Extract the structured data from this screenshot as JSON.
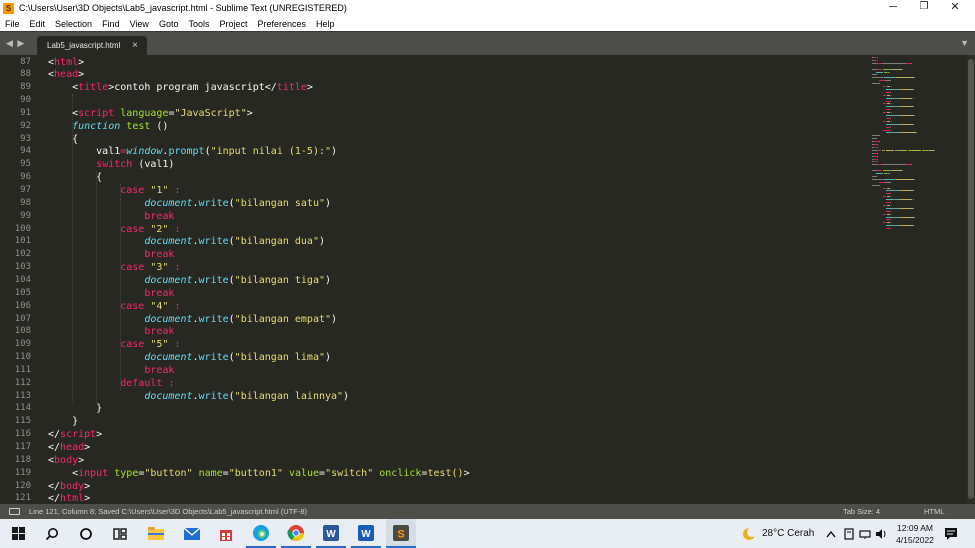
{
  "window": {
    "title": "C:\\Users\\User\\3D Objects\\Lab5_javascript.html - Sublime Text (UNREGISTERED)",
    "minimize": "─",
    "restore": "❐",
    "close": "✕"
  },
  "menu": [
    "File",
    "Edit",
    "Selection",
    "Find",
    "View",
    "Goto",
    "Tools",
    "Project",
    "Preferences",
    "Help"
  ],
  "tabbar": {
    "nav_arrows": "◀ ▶",
    "active_tab": "Lab5_javascript.html",
    "close_glyph": "×",
    "overflow_glyph": "▼"
  },
  "editor": {
    "line_numbers": [
      "87",
      "88",
      "89",
      "90",
      "91",
      "92",
      "93",
      "94",
      "95",
      "96",
      "97",
      "98",
      "99",
      "100",
      "101",
      "102",
      "103",
      "104",
      "105",
      "106",
      "107",
      "108",
      "109",
      "110",
      "111",
      "112",
      "113",
      "114",
      "115",
      "116",
      "117",
      "118",
      "119",
      "120",
      "121"
    ],
    "colors": {
      "background": "#272822",
      "tag": "#f92672",
      "attribute": "#a6e22e",
      "string": "#e6db74",
      "storage": "#66d9ef",
      "text": "#f8f8f2",
      "gutter": "#8f908a"
    },
    "lines": [
      [
        {
          "t": "<",
          "c": "text"
        },
        {
          "t": "html",
          "c": "tag"
        },
        {
          "t": ">",
          "c": "text"
        }
      ],
      [
        {
          "t": "<",
          "c": "text"
        },
        {
          "t": "head",
          "c": "tag"
        },
        {
          "t": ">",
          "c": "text"
        }
      ],
      [
        {
          "t": "    <",
          "c": "text"
        },
        {
          "t": "title",
          "c": "tag"
        },
        {
          "t": ">contoh program javascript</",
          "c": "text"
        },
        {
          "t": "title",
          "c": "tag"
        },
        {
          "t": ">",
          "c": "text"
        }
      ],
      [
        {
          "t": "",
          "c": "text"
        }
      ],
      [
        {
          "t": "    <",
          "c": "text"
        },
        {
          "t": "script",
          "c": "tag"
        },
        {
          "t": " ",
          "c": "text"
        },
        {
          "t": "language",
          "c": "attr"
        },
        {
          "t": "=",
          "c": "text"
        },
        {
          "t": "\"JavaScript\"",
          "c": "str"
        },
        {
          "t": ">",
          "c": "text"
        }
      ],
      [
        {
          "t": "    ",
          "c": "text"
        },
        {
          "t": "function",
          "c": "stor"
        },
        {
          "t": " ",
          "c": "text"
        },
        {
          "t": "test",
          "c": "fn"
        },
        {
          "t": " ()",
          "c": "text"
        }
      ],
      [
        {
          "t": "    {",
          "c": "text"
        }
      ],
      [
        {
          "t": "        val1",
          "c": "text"
        },
        {
          "t": "=",
          "c": "kw"
        },
        {
          "t": "window",
          "c": "obj"
        },
        {
          "t": ".",
          "c": "text"
        },
        {
          "t": "prompt",
          "c": "meth"
        },
        {
          "t": "(",
          "c": "text"
        },
        {
          "t": "\"input nilai (1-5):\"",
          "c": "str"
        },
        {
          "t": ")",
          "c": "text"
        }
      ],
      [
        {
          "t": "        ",
          "c": "text"
        },
        {
          "t": "switch",
          "c": "kw"
        },
        {
          "t": " (val1)",
          "c": "text"
        }
      ],
      [
        {
          "t": "        {",
          "c": "text"
        }
      ],
      [
        {
          "t": "            ",
          "c": "text"
        },
        {
          "t": "case",
          "c": "kw"
        },
        {
          "t": " ",
          "c": "text"
        },
        {
          "t": "\"1\"",
          "c": "str"
        },
        {
          "t": " ",
          "c": "text"
        },
        {
          "t": ":",
          "c": "kw"
        }
      ],
      [
        {
          "t": "                ",
          "c": "text"
        },
        {
          "t": "document",
          "c": "obj"
        },
        {
          "t": ".",
          "c": "text"
        },
        {
          "t": "write",
          "c": "meth"
        },
        {
          "t": "(",
          "c": "text"
        },
        {
          "t": "\"bilangan satu\"",
          "c": "str"
        },
        {
          "t": ")",
          "c": "text"
        }
      ],
      [
        {
          "t": "                ",
          "c": "text"
        },
        {
          "t": "break",
          "c": "kw"
        }
      ],
      [
        {
          "t": "            ",
          "c": "text"
        },
        {
          "t": "case",
          "c": "kw"
        },
        {
          "t": " ",
          "c": "text"
        },
        {
          "t": "\"2\"",
          "c": "str"
        },
        {
          "t": " ",
          "c": "text"
        },
        {
          "t": ":",
          "c": "kw"
        }
      ],
      [
        {
          "t": "                ",
          "c": "text"
        },
        {
          "t": "document",
          "c": "obj"
        },
        {
          "t": ".",
          "c": "text"
        },
        {
          "t": "write",
          "c": "meth"
        },
        {
          "t": "(",
          "c": "text"
        },
        {
          "t": "\"bilangan dua\"",
          "c": "str"
        },
        {
          "t": ")",
          "c": "text"
        }
      ],
      [
        {
          "t": "                ",
          "c": "text"
        },
        {
          "t": "break",
          "c": "kw"
        }
      ],
      [
        {
          "t": "            ",
          "c": "text"
        },
        {
          "t": "case",
          "c": "kw"
        },
        {
          "t": " ",
          "c": "text"
        },
        {
          "t": "\"3\"",
          "c": "str"
        },
        {
          "t": " ",
          "c": "text"
        },
        {
          "t": ":",
          "c": "kw"
        }
      ],
      [
        {
          "t": "                ",
          "c": "text"
        },
        {
          "t": "document",
          "c": "obj"
        },
        {
          "t": ".",
          "c": "text"
        },
        {
          "t": "write",
          "c": "meth"
        },
        {
          "t": "(",
          "c": "text"
        },
        {
          "t": "\"bilangan tiga\"",
          "c": "str"
        },
        {
          "t": ")",
          "c": "text"
        }
      ],
      [
        {
          "t": "                ",
          "c": "text"
        },
        {
          "t": "break",
          "c": "kw"
        }
      ],
      [
        {
          "t": "            ",
          "c": "text"
        },
        {
          "t": "case",
          "c": "kw"
        },
        {
          "t": " ",
          "c": "text"
        },
        {
          "t": "\"4\"",
          "c": "str"
        },
        {
          "t": " ",
          "c": "text"
        },
        {
          "t": ":",
          "c": "kw"
        }
      ],
      [
        {
          "t": "                ",
          "c": "text"
        },
        {
          "t": "document",
          "c": "obj"
        },
        {
          "t": ".",
          "c": "text"
        },
        {
          "t": "write",
          "c": "meth"
        },
        {
          "t": "(",
          "c": "text"
        },
        {
          "t": "\"bilangan empat\"",
          "c": "str"
        },
        {
          "t": ")",
          "c": "text"
        }
      ],
      [
        {
          "t": "                ",
          "c": "text"
        },
        {
          "t": "break",
          "c": "kw"
        }
      ],
      [
        {
          "t": "            ",
          "c": "text"
        },
        {
          "t": "case",
          "c": "kw"
        },
        {
          "t": " ",
          "c": "text"
        },
        {
          "t": "\"5\"",
          "c": "str"
        },
        {
          "t": " ",
          "c": "text"
        },
        {
          "t": ":",
          "c": "kw"
        }
      ],
      [
        {
          "t": "                ",
          "c": "text"
        },
        {
          "t": "document",
          "c": "obj"
        },
        {
          "t": ".",
          "c": "text"
        },
        {
          "t": "write",
          "c": "meth"
        },
        {
          "t": "(",
          "c": "text"
        },
        {
          "t": "\"bilangan lima\"",
          "c": "str"
        },
        {
          "t": ")",
          "c": "text"
        }
      ],
      [
        {
          "t": "                ",
          "c": "text"
        },
        {
          "t": "break",
          "c": "kw"
        }
      ],
      [
        {
          "t": "            ",
          "c": "text"
        },
        {
          "t": "default",
          "c": "kw"
        },
        {
          "t": " ",
          "c": "text"
        },
        {
          "t": ":",
          "c": "kw"
        }
      ],
      [
        {
          "t": "                ",
          "c": "text"
        },
        {
          "t": "document",
          "c": "obj"
        },
        {
          "t": ".",
          "c": "text"
        },
        {
          "t": "write",
          "c": "meth"
        },
        {
          "t": "(",
          "c": "text"
        },
        {
          "t": "\"bilangan lainnya\"",
          "c": "str"
        },
        {
          "t": ")",
          "c": "text"
        }
      ],
      [
        {
          "t": "        }",
          "c": "text"
        }
      ],
      [
        {
          "t": "    }",
          "c": "text"
        }
      ],
      [
        {
          "t": "</",
          "c": "text"
        },
        {
          "t": "script",
          "c": "tag"
        },
        {
          "t": ">",
          "c": "text"
        }
      ],
      [
        {
          "t": "</",
          "c": "text"
        },
        {
          "t": "head",
          "c": "tag"
        },
        {
          "t": ">",
          "c": "text"
        }
      ],
      [
        {
          "t": "<",
          "c": "text"
        },
        {
          "t": "body",
          "c": "tag"
        },
        {
          "t": ">",
          "c": "text"
        }
      ],
      [
        {
          "t": "    <",
          "c": "text"
        },
        {
          "t": "input",
          "c": "tag"
        },
        {
          "t": " ",
          "c": "text"
        },
        {
          "t": "type",
          "c": "attr"
        },
        {
          "t": "=",
          "c": "text"
        },
        {
          "t": "\"button\"",
          "c": "str"
        },
        {
          "t": " ",
          "c": "text"
        },
        {
          "t": "name",
          "c": "attr"
        },
        {
          "t": "=",
          "c": "text"
        },
        {
          "t": "\"button1\"",
          "c": "str"
        },
        {
          "t": " ",
          "c": "text"
        },
        {
          "t": "value",
          "c": "attr"
        },
        {
          "t": "=",
          "c": "text"
        },
        {
          "t": "\"switch\"",
          "c": "str"
        },
        {
          "t": " ",
          "c": "text"
        },
        {
          "t": "onclick",
          "c": "attr"
        },
        {
          "t": "=",
          "c": "text"
        },
        {
          "t": "test()",
          "c": "str"
        },
        {
          "t": ">",
          "c": "text"
        }
      ],
      [
        {
          "t": "</",
          "c": "text"
        },
        {
          "t": "body",
          "c": "tag"
        },
        {
          "t": ">",
          "c": "text"
        }
      ],
      [
        {
          "t": "</",
          "c": "text"
        },
        {
          "t": "html",
          "c": "tag"
        },
        {
          "t": ">",
          "c": "text"
        }
      ]
    ]
  },
  "status": {
    "message": "Line 121, Column 8; Saved C:\\Users\\User\\3D Objects\\Lab5_javascript.html (UTF-8)",
    "tab_size": "Tab Size: 4",
    "syntax": "HTML"
  },
  "taskbar": {
    "items": [
      {
        "name": "start",
        "icon": "windows-logo-icon"
      },
      {
        "name": "search",
        "icon": "search-icon"
      },
      {
        "name": "cortana",
        "icon": "circle-icon"
      },
      {
        "name": "task-view",
        "icon": "task-view-icon"
      },
      {
        "name": "file-explorer",
        "icon": "folder-icon"
      },
      {
        "name": "mail",
        "icon": "mail-icon"
      },
      {
        "name": "store",
        "icon": "store-icon"
      },
      {
        "name": "edge",
        "icon": "edge-icon"
      },
      {
        "name": "chrome",
        "icon": "chrome-icon"
      },
      {
        "name": "word-a",
        "icon": "word-icon"
      },
      {
        "name": "word-b",
        "icon": "word-icon"
      },
      {
        "name": "sublime",
        "icon": "sublime-icon"
      }
    ],
    "weather": "28°C  Cerah",
    "time": "12:09 AM",
    "date": "4/15/2022"
  }
}
